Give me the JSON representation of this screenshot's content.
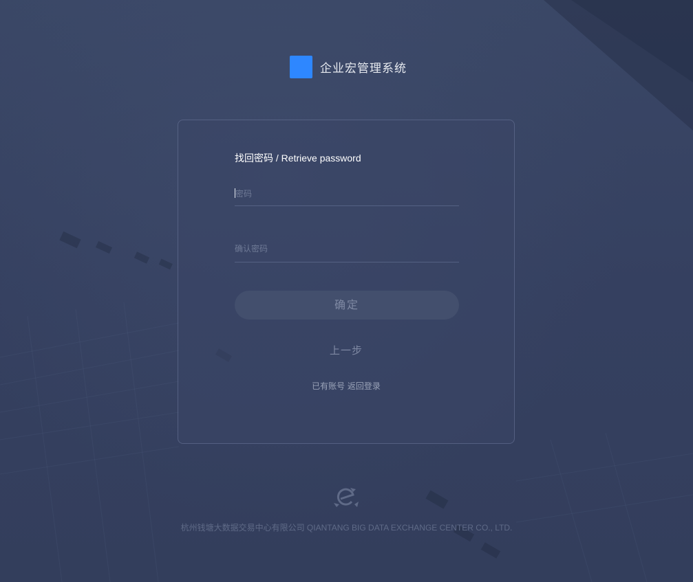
{
  "app": {
    "title": "企业宏管理系统",
    "brand_color": "#2e87ff"
  },
  "form": {
    "heading": "找回密码 / Retrieve password",
    "password_placeholder": "密码",
    "confirm_password_placeholder": "确认密码",
    "submit_label": "确定",
    "back_label": "上一步",
    "has_account_text": "已有账号",
    "back_to_login_label": "返回登录"
  },
  "footer": {
    "logo_icon": "exchange-center-logo-icon",
    "company": "杭州钱塘大数据交易中心有限公司 QIANTANG BIG DATA EXCHANGE CENTER CO., LTD."
  },
  "colors": {
    "background": "#364260",
    "button_bg": "#434f6d"
  }
}
